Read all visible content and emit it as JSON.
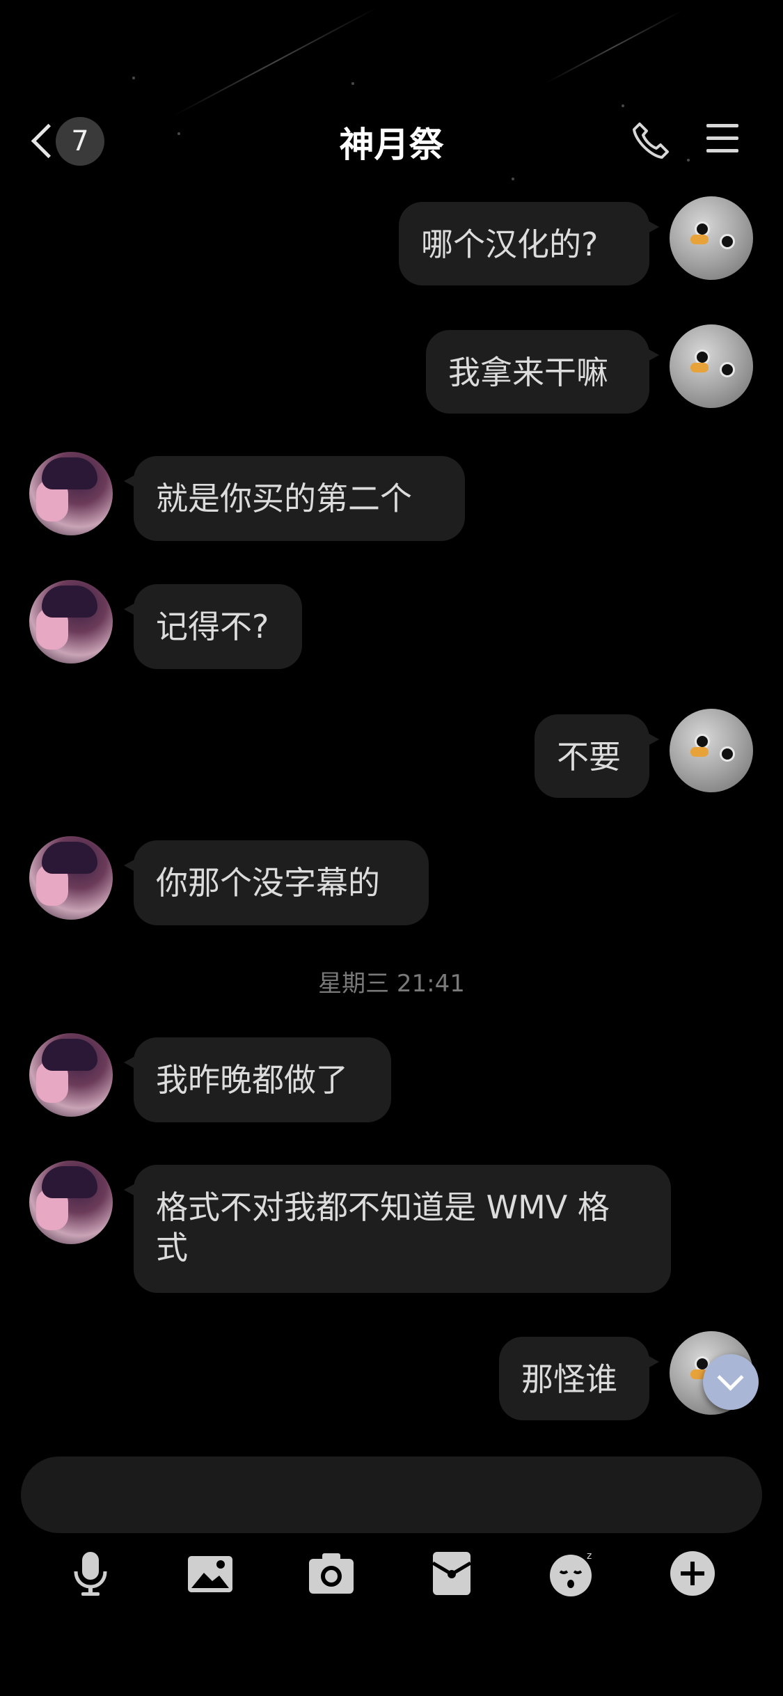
{
  "header": {
    "back_badge": "7",
    "title": "神月祭",
    "phone_icon": "phone-icon",
    "menu_icon": "menu-icon"
  },
  "messages": [
    {
      "side": "me",
      "text": "哪个汉化的?"
    },
    {
      "side": "me",
      "text": "我拿来干嘛"
    },
    {
      "side": "them",
      "text": "就是你买的第二个"
    },
    {
      "side": "them",
      "text": "记得不?"
    },
    {
      "side": "me",
      "text": "不要"
    },
    {
      "side": "them",
      "text": "你那个没字幕的"
    },
    {
      "side": "them",
      "text": "我昨晚都做了"
    },
    {
      "side": "them",
      "text": "格式不对我都不知道是 WMV 格\n式"
    },
    {
      "side": "me",
      "text": "那怪谁"
    }
  ],
  "timestamp": "星期三 21:41",
  "input": {
    "value": "",
    "placeholder": ""
  },
  "toolbar": {
    "icons": [
      "microphone-icon",
      "image-icon",
      "camera-icon",
      "red-packet-icon",
      "emoji-icon",
      "plus-icon"
    ]
  },
  "colors": {
    "background": "#000000",
    "bubble": "#1e1e1e",
    "scroll_button": "#a9b6d6"
  }
}
